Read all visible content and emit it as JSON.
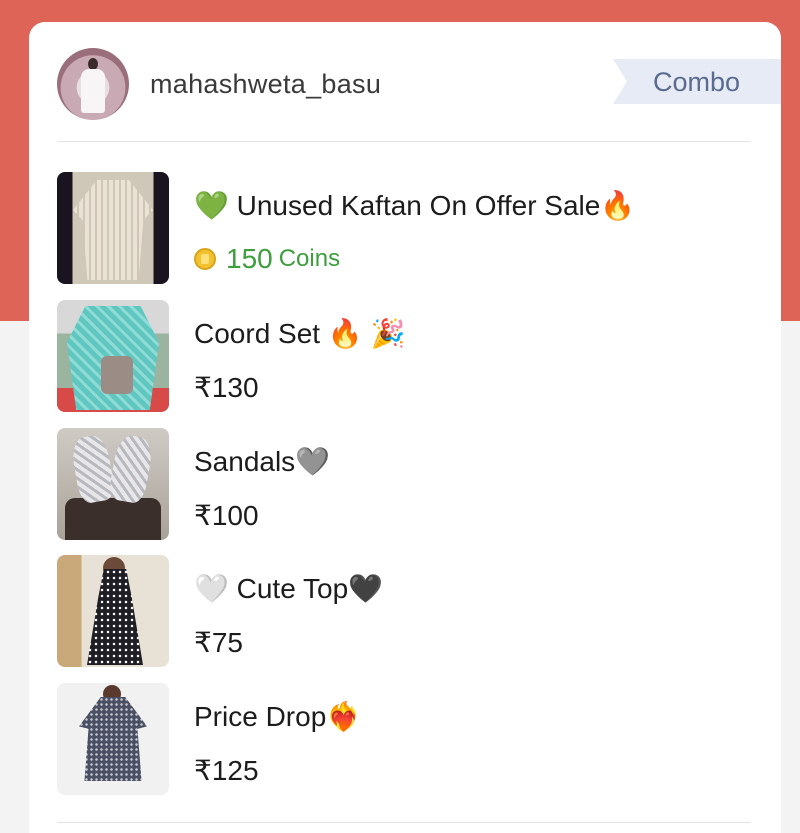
{
  "header": {
    "username": "mahashweta_basu",
    "tag_label": "Combo"
  },
  "items": [
    {
      "title": "💚 Unused Kaftan On Offer Sale🔥",
      "price_type": "coins",
      "coins_value": "150",
      "coins_unit": "Coins"
    },
    {
      "title": "Coord Set 🔥 🎉",
      "price": "₹130"
    },
    {
      "title": "Sandals🩶",
      "price": "₹100"
    },
    {
      "title": "🤍 Cute Top🖤",
      "price": "₹75"
    },
    {
      "title": "Price Drop❤️‍🔥",
      "price": "₹125"
    }
  ],
  "colors": {
    "background_band": "#de6458",
    "coins_green": "#3c9e3c",
    "tag_text": "#5a6b8f",
    "tag_bg": "#e6ebf5"
  }
}
